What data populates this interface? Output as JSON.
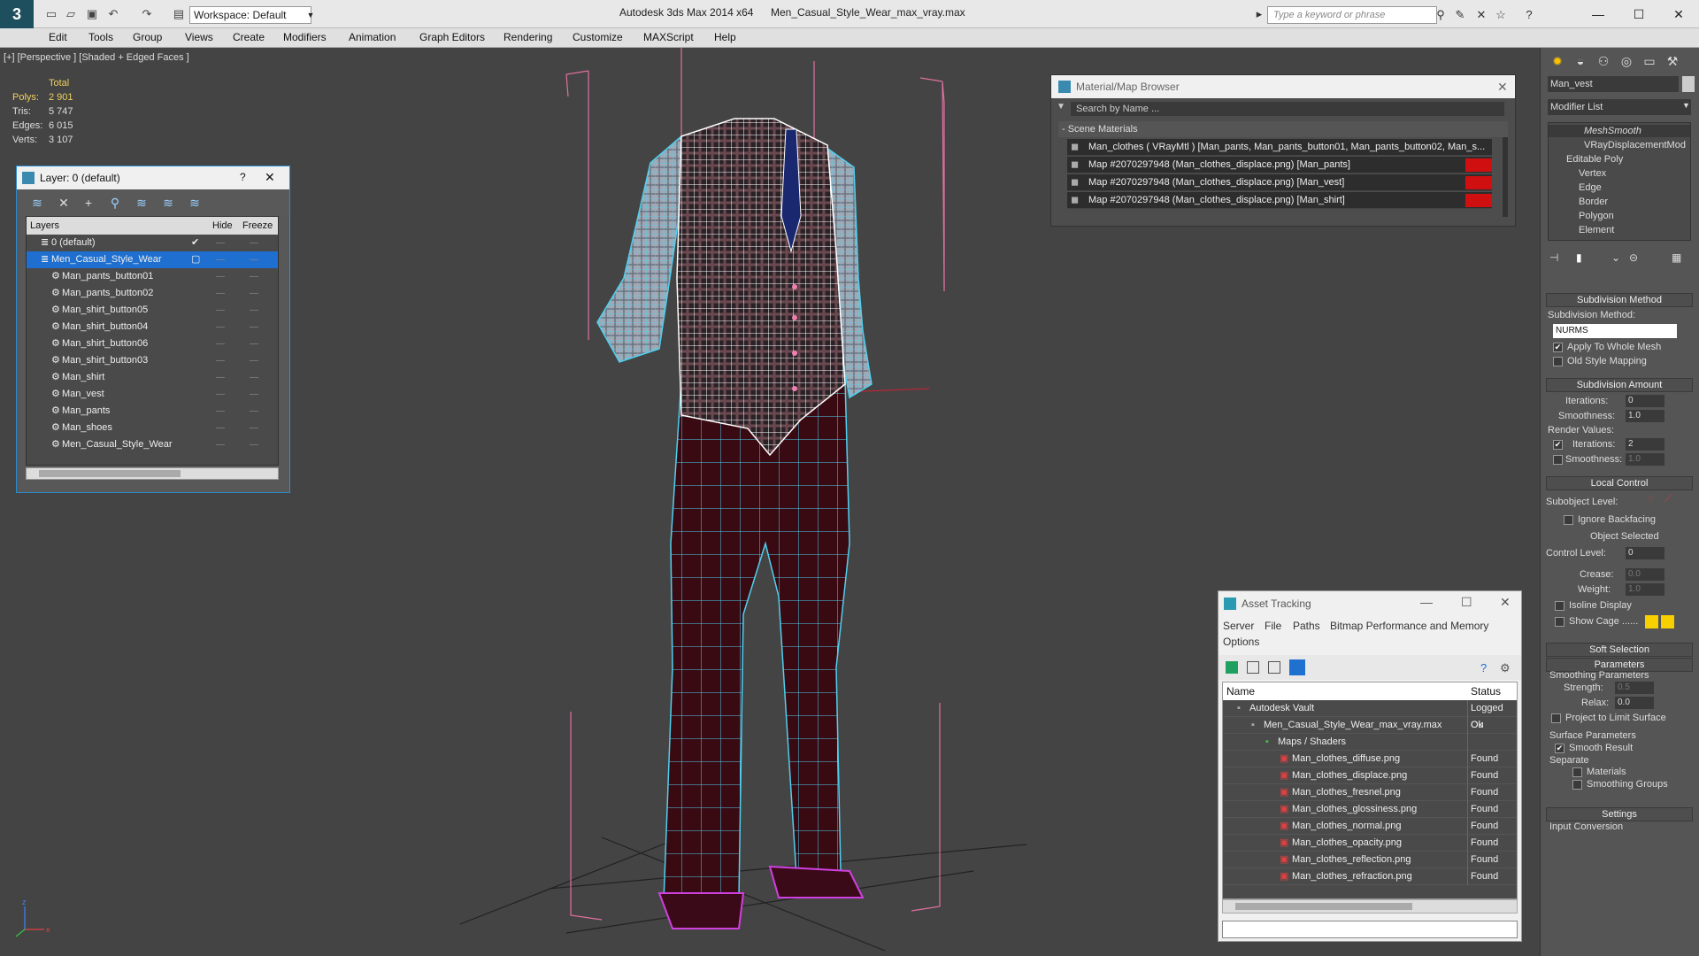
{
  "titlebar": {
    "workspace": "Workspace: Default",
    "app_title": "Autodesk 3ds Max  2014 x64",
    "doc_title": "Men_Casual_Style_Wear_max_vray.max",
    "search_placeholder": "Type a keyword or phrase"
  },
  "menu": [
    "Edit",
    "Tools",
    "Group",
    "Views",
    "Create",
    "Modifiers",
    "Animation",
    "Graph Editors",
    "Rendering",
    "Customize",
    "MAXScript",
    "Help"
  ],
  "viewport": {
    "label": "[+] [Perspective ] [Shaded + Edged Faces ]",
    "stats": {
      "header": "Total",
      "rows": [
        {
          "label": "Polys:",
          "value": "2 901"
        },
        {
          "label": "Tris:",
          "value": "5 747"
        },
        {
          "label": "Edges:",
          "value": "6 015"
        },
        {
          "label": "Verts:",
          "value": "3 107"
        }
      ]
    },
    "axis": {
      "z": "z",
      "x": "x"
    }
  },
  "layer_dialog": {
    "title": "Layer: 0 (default)",
    "help": "?",
    "columns": {
      "layers": "Layers",
      "hide": "Hide",
      "freeze": "Freeze"
    },
    "rows": [
      {
        "name": "0 (default)"
      },
      {
        "name": "Men_Casual_Style_Wear"
      },
      {
        "name": "Man_pants_button01"
      },
      {
        "name": "Man_pants_button02"
      },
      {
        "name": "Man_shirt_button05"
      },
      {
        "name": "Man_shirt_button04"
      },
      {
        "name": "Man_shirt_button06"
      },
      {
        "name": "Man_shirt_button03"
      },
      {
        "name": "Man_shirt"
      },
      {
        "name": "Man_vest"
      },
      {
        "name": "Man_pants"
      },
      {
        "name": "Man_shoes"
      },
      {
        "name": "Men_Casual_Style_Wear"
      }
    ]
  },
  "material_browser": {
    "title": "Material/Map Browser",
    "search": "Search by Name ...",
    "section": "- Scene Materials",
    "rows": [
      "Man_clothes  ( VRayMtl ) [Man_pants, Man_pants_button01, Man_pants_button02, Man_s...",
      "Map #2070297948 (Man_clothes_displace.png) [Man_pants]",
      "Map #2070297948 (Man_clothes_displace.png) [Man_vest]",
      "Map #2070297948 (Man_clothes_displace.png) [Man_shirt]"
    ]
  },
  "asset_tracking": {
    "title": "Asset Tracking",
    "menu": [
      "Server",
      "File",
      "Paths",
      "Bitmap Performance and Memory",
      "Options"
    ],
    "columns": {
      "name": "Name",
      "status": "Status"
    },
    "rows": [
      {
        "name": "Autodesk Vault",
        "status": "Logged Ou",
        "indent": 0
      },
      {
        "name": "Men_Casual_Style_Wear_max_vray.max",
        "status": "Ok",
        "indent": 1
      },
      {
        "name": "Maps / Shaders",
        "status": "",
        "indent": 2
      },
      {
        "name": "Man_clothes_diffuse.png",
        "status": "Found",
        "indent": 3
      },
      {
        "name": "Man_clothes_displace.png",
        "status": "Found",
        "indent": 3
      },
      {
        "name": "Man_clothes_fresnel.png",
        "status": "Found",
        "indent": 3
      },
      {
        "name": "Man_clothes_glossiness.png",
        "status": "Found",
        "indent": 3
      },
      {
        "name": "Man_clothes_normal.png",
        "status": "Found",
        "indent": 3
      },
      {
        "name": "Man_clothes_opacity.png",
        "status": "Found",
        "indent": 3
      },
      {
        "name": "Man_clothes_reflection.png",
        "status": "Found",
        "indent": 3
      },
      {
        "name": "Man_clothes_refraction.png",
        "status": "Found",
        "indent": 3
      }
    ]
  },
  "command_panel": {
    "object_name": "Man_vest",
    "modifier_list": "Modifier List",
    "stack": [
      "MeshSmooth",
      "VRayDisplacementMod",
      "Editable Poly",
      "Vertex",
      "Edge",
      "Border",
      "Polygon",
      "Element"
    ],
    "subdivision_method": {
      "rollout": "Subdivision Method",
      "label": "Subdivision Method:",
      "value": "NURMS",
      "apply_whole": "Apply To Whole Mesh",
      "old_style": "Old Style Mapping"
    },
    "subdivision_amount": {
      "rollout": "Subdivision Amount",
      "iterations_label": "Iterations:",
      "iterations": "0",
      "smoothness_label": "Smoothness:",
      "smoothness": "1.0",
      "render_values": "Render Values:",
      "r_iterations_label": "Iterations:",
      "r_iterations": "2",
      "r_smoothness_label": "Smoothness:",
      "r_smoothness": "1.0"
    },
    "local_control": {
      "rollout": "Local Control",
      "subobject": "Subobject Level:",
      "ignore_backfacing": "Ignore Backfacing",
      "object_selected": "Object Selected",
      "control_level_label": "Control Level:",
      "control_level": "0",
      "crease_label": "Crease:",
      "crease": "0.0",
      "weight_label": "Weight:",
      "weight": "1.0",
      "isoline": "Isoline Display",
      "show_cage": "Show Cage ......"
    },
    "soft_selection": "Soft Selection",
    "parameters": {
      "rollout": "Parameters",
      "smoothing": "Smoothing Parameters",
      "strength_label": "Strength:",
      "strength": "0.5",
      "relax_label": "Relax:",
      "relax": "0.0",
      "project": "Project to Limit Surface",
      "surface": "Surface Parameters",
      "smooth_result": "Smooth Result",
      "separate": "Separate",
      "materials": "Materials",
      "smoothing_groups": "Smoothing Groups"
    },
    "settings": "Settings",
    "input_conversion": "Input Conversion"
  }
}
